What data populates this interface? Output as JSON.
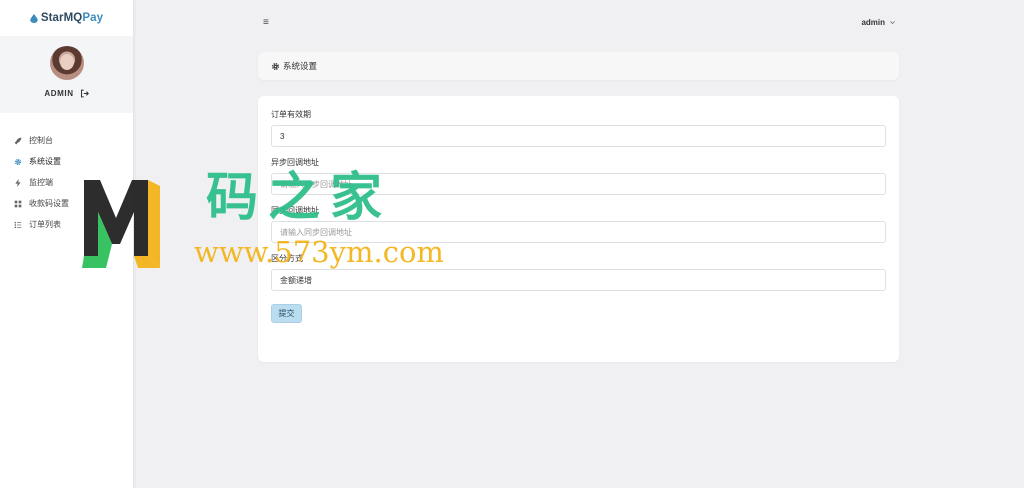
{
  "brand": {
    "name_prefix": "StarMQ",
    "name_suffix": "Pay"
  },
  "profile": {
    "name": "ADMIN"
  },
  "sidebar": {
    "items": [
      {
        "label": "控制台",
        "icon": "rocket-icon",
        "active": false
      },
      {
        "label": "系统设置",
        "icon": "gear-icon",
        "active": true
      },
      {
        "label": "监控端",
        "icon": "bolt-icon",
        "active": false
      },
      {
        "label": "收款码设置",
        "icon": "grid-icon",
        "active": false
      },
      {
        "label": "订单列表",
        "icon": "list-icon",
        "active": false
      }
    ]
  },
  "topbar": {
    "menu_icon": "≡",
    "user": "admin"
  },
  "page": {
    "title": "系统设置"
  },
  "form": {
    "fields": [
      {
        "label": "订单有效期",
        "value": "3",
        "placeholder": ""
      },
      {
        "label": "异步回调地址",
        "value": "",
        "placeholder": "请输入异步回调地址"
      },
      {
        "label": "同步回调地址",
        "value": "",
        "placeholder": "请输入同步回调地址"
      },
      {
        "label": "区分方式",
        "value": "金额递增",
        "placeholder": ""
      }
    ],
    "submit_label": "提交"
  },
  "watermark": {
    "cn": "码之家",
    "url": "www.573ym.com"
  },
  "colors": {
    "accent": "#3c8dbc",
    "brand_dark": "#2d4a62",
    "watermark_green": "#2fbf8b",
    "watermark_gold": "#f4b41a"
  }
}
